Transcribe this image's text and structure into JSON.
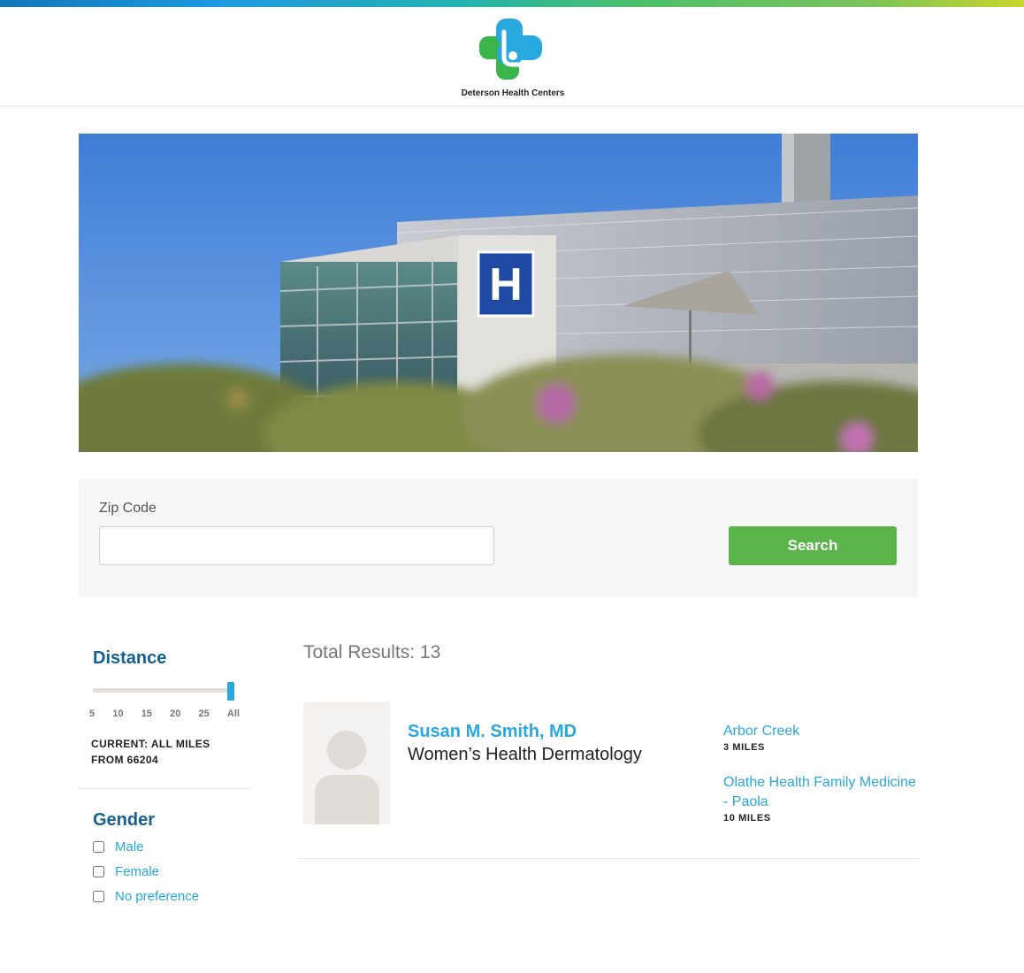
{
  "brand": {
    "name": "Deterson Health Centers",
    "colors": {
      "primary_blue": "#29a8e0",
      "dark_blue": "#14618f",
      "green": "#5bb44a"
    }
  },
  "hero": {
    "sign_letter": "H"
  },
  "search": {
    "zip_label": "Zip Code",
    "zip_value": "",
    "zip_placeholder": "",
    "search_button": "Search"
  },
  "filters": {
    "distance": {
      "title": "Distance",
      "ticks": [
        "5",
        "10",
        "15",
        "20",
        "25",
        "All"
      ],
      "selected": "All",
      "current_text": "CURRENT: ALL MILES FROM 66204"
    },
    "gender": {
      "title": "Gender",
      "options": [
        {
          "label": "Male",
          "checked": false
        },
        {
          "label": "Female",
          "checked": false
        },
        {
          "label": "No preference",
          "checked": false
        }
      ]
    }
  },
  "results": {
    "total_text": "Total Results: 13",
    "items": [
      {
        "name": "Susan M. Smith, MD",
        "specialty": "Women’s Health Dermatology",
        "locations": [
          {
            "name": "Arbor Creek",
            "distance": "3 MILES"
          },
          {
            "name": "Olathe Health Family Medicine - Paola",
            "distance": "10 MILES"
          }
        ]
      }
    ]
  }
}
